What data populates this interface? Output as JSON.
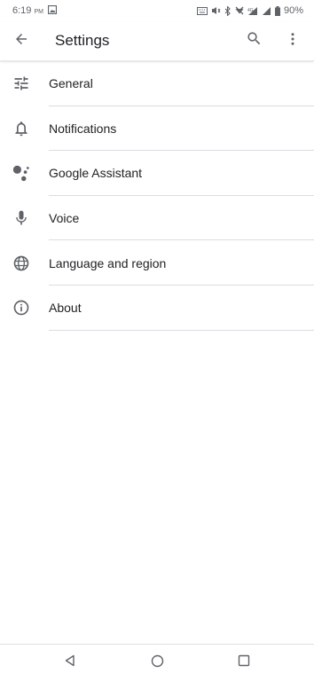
{
  "status_bar": {
    "time": "6:19",
    "ampm": "PM",
    "battery": "90%"
  },
  "app_bar": {
    "title": "Settings",
    "back_icon": "arrow-back-icon",
    "search_icon": "search-icon",
    "more_icon": "more-vert-icon"
  },
  "settings": {
    "items": [
      {
        "label": "General",
        "icon": "tune-icon"
      },
      {
        "label": "Notifications",
        "icon": "bell-icon"
      },
      {
        "label": "Google Assistant",
        "icon": "assistant-icon"
      },
      {
        "label": "Voice",
        "icon": "mic-icon"
      },
      {
        "label": "Language and region",
        "icon": "globe-icon"
      },
      {
        "label": "About",
        "icon": "info-icon"
      }
    ]
  },
  "colors": {
    "icon": "#5f6368",
    "text": "#202124",
    "divider": "#dadce0"
  }
}
